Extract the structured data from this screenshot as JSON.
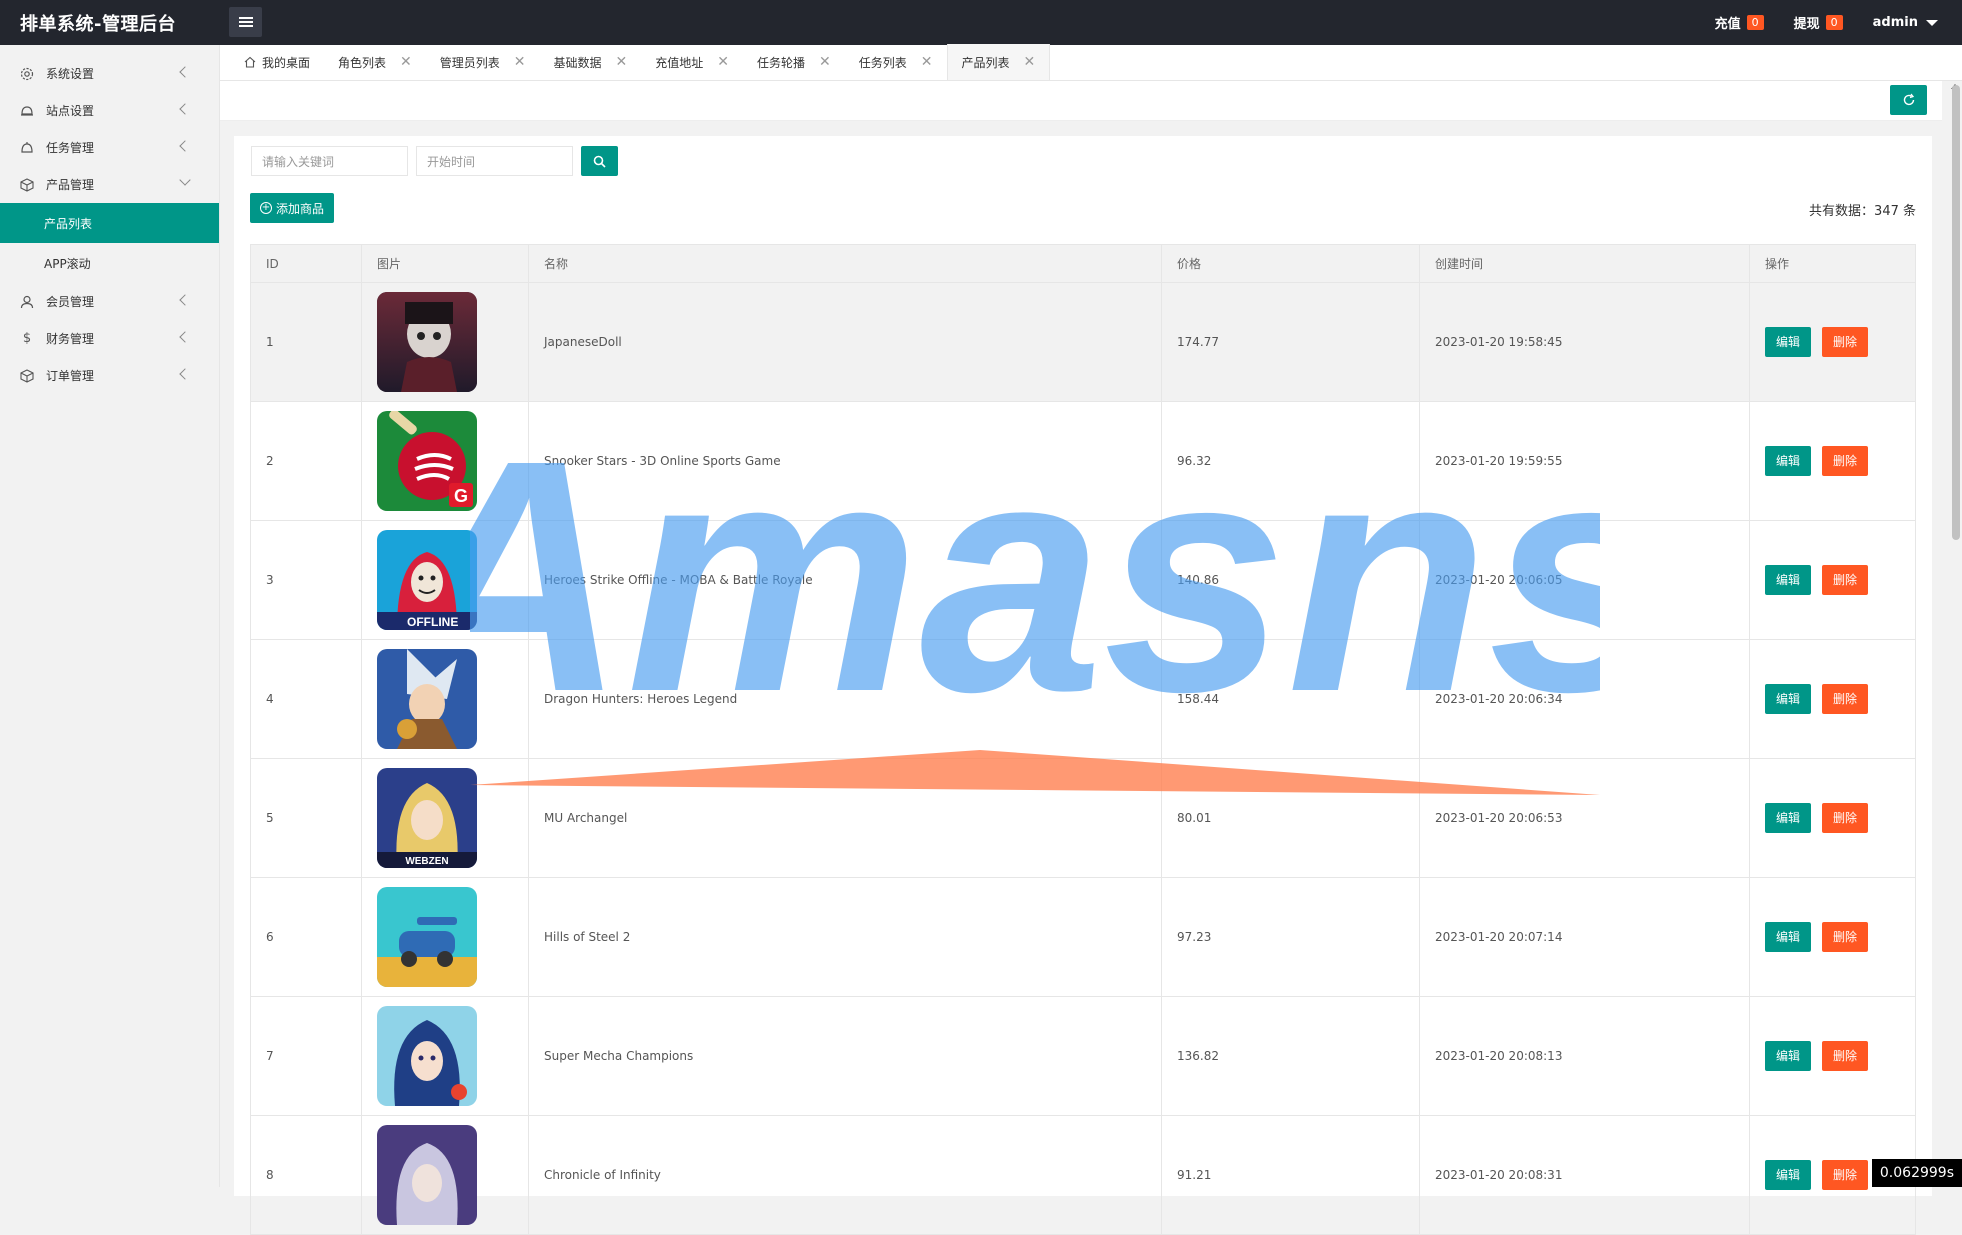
{
  "app": {
    "title": "排单系统-管理后台"
  },
  "topbar": {
    "recharge_label": "充值",
    "recharge_count": "0",
    "withdraw_label": "提现",
    "withdraw_count": "0",
    "user": "admin"
  },
  "sidebar": {
    "items": [
      {
        "label": "系统设置",
        "icon": "gear-icon"
      },
      {
        "label": "站点设置",
        "icon": "site-icon"
      },
      {
        "label": "任务管理",
        "icon": "task-icon"
      },
      {
        "label": "产品管理",
        "icon": "box-icon"
      },
      {
        "label": "会员管理",
        "icon": "user-icon"
      },
      {
        "label": "财务管理",
        "icon": "dollar-icon"
      },
      {
        "label": "订单管理",
        "icon": "order-icon"
      }
    ],
    "sub_items": [
      {
        "label": "产品列表",
        "active": true
      },
      {
        "label": "APP滚动",
        "active": false
      }
    ]
  },
  "tabs": [
    {
      "label": "我的桌面"
    },
    {
      "label": "角色列表"
    },
    {
      "label": "管理员列表"
    },
    {
      "label": "基础数据"
    },
    {
      "label": "充值地址"
    },
    {
      "label": "任务轮播"
    },
    {
      "label": "任务列表"
    },
    {
      "label": "产品列表"
    }
  ],
  "search": {
    "keyword_placeholder": "请输入关键词",
    "date_placeholder": "开始时间"
  },
  "toolbar": {
    "add_label": "添加商品",
    "total_label": "共有数据：347 条"
  },
  "table": {
    "headers": [
      "ID",
      "图片",
      "名称",
      "价格",
      "创建时间",
      "操作"
    ],
    "edit_label": "编辑",
    "delete_label": "删除",
    "rows": [
      {
        "id": "1",
        "name": "JapaneseDoll",
        "price": "174.77",
        "created": "2023-01-20 19:58:45"
      },
      {
        "id": "2",
        "name": "Snooker Stars - 3D Online Sports Game",
        "price": "96.32",
        "created": "2023-01-20 19:59:55"
      },
      {
        "id": "3",
        "name": "Heroes Strike Offline - MOBA & Battle Royale",
        "price": "140.86",
        "created": "2023-01-20 20:06:05"
      },
      {
        "id": "4",
        "name": "Dragon Hunters: Heroes Legend",
        "price": "158.44",
        "created": "2023-01-20 20:06:34"
      },
      {
        "id": "5",
        "name": "MU Archangel",
        "price": "80.01",
        "created": "2023-01-20 20:06:53"
      },
      {
        "id": "6",
        "name": "Hills of Steel 2",
        "price": "97.23",
        "created": "2023-01-20 20:07:14"
      },
      {
        "id": "7",
        "name": "Super Mecha Champions",
        "price": "136.82",
        "created": "2023-01-20 20:08:13"
      },
      {
        "id": "8",
        "name": "Chronicle of Infinity",
        "price": "91.21",
        "created": "2023-01-20 20:08:31"
      }
    ]
  },
  "watermark": {
    "text": "Amasns"
  },
  "timer": "0.062999s",
  "colors": {
    "primary": "#009688",
    "danger": "#ff5722",
    "topbar": "#23262e"
  }
}
